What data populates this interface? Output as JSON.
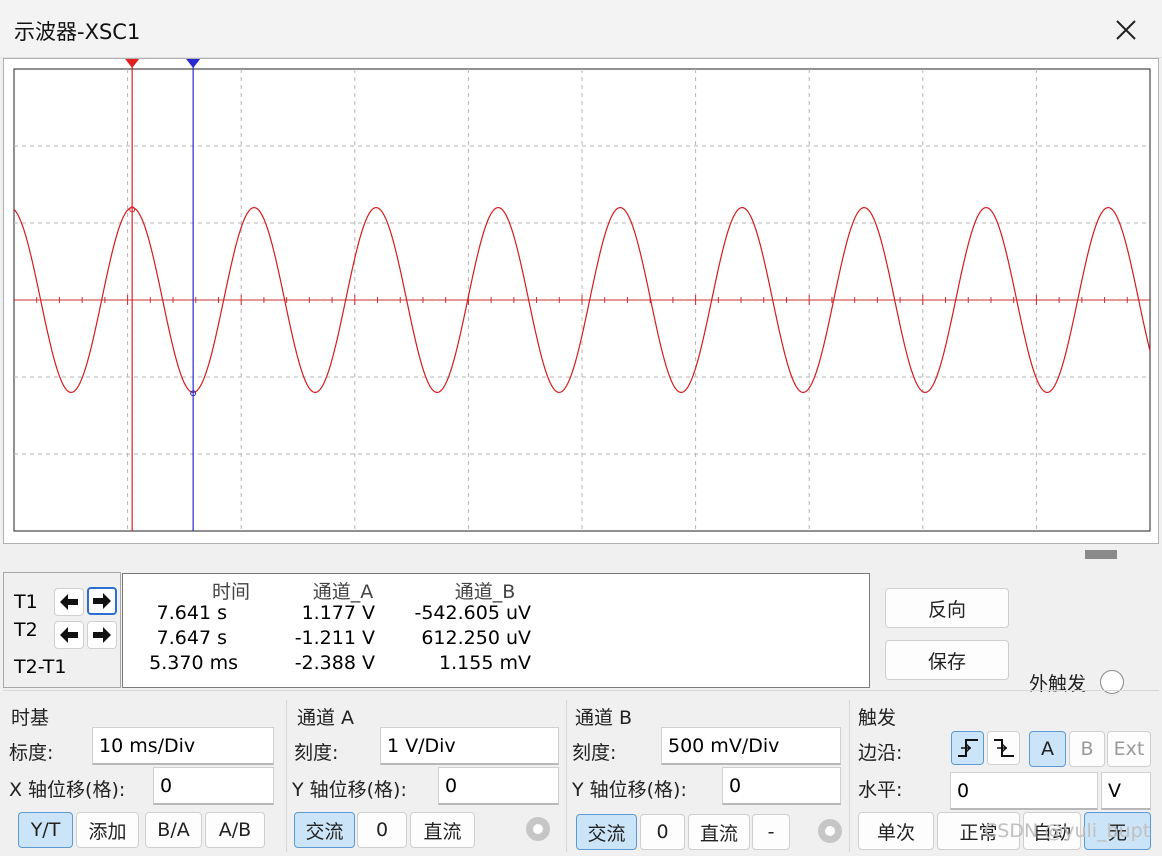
{
  "window": {
    "title": "示波器-XSC1"
  },
  "chart_data": {
    "type": "line",
    "title": "",
    "xlabel": "",
    "ylabel": "",
    "time_per_div_ms": 10,
    "volts_per_div": 1,
    "grid": true,
    "series": [
      {
        "channel": "A",
        "color": "#d41c1c",
        "waveform": "sine",
        "amplitude_V": 1.2,
        "period_ms": 10.74,
        "x_start_ms": -10.4,
        "x_end_ms": 89.6
      }
    ],
    "cursors": [
      {
        "name": "T1",
        "color": "#e02020",
        "t_ms": 0,
        "value_V": 1.177
      },
      {
        "name": "T2",
        "color": "#2a2ad0",
        "t_ms": 5.37,
        "value_V": -1.211
      }
    ]
  },
  "cursors_panel": {
    "t1": "T1",
    "t2": "T2",
    "diff": "T2-T1"
  },
  "readout": {
    "headers": {
      "time": "时间",
      "ch_a": "通道_A",
      "ch_b": "通道_B"
    },
    "t1": {
      "time": "7.641 s",
      "a": "1.177 V",
      "b": "-542.605 uV"
    },
    "t2": {
      "time": "7.647 s",
      "a": "-1.211 V",
      "b": "612.250 uV"
    },
    "diff": {
      "time": "5.370 ms",
      "a": "-2.388 V",
      "b": "1.155 mV"
    }
  },
  "actions": {
    "reverse": "反向",
    "save": "保存",
    "ext_trigger": "外触发"
  },
  "timebase": {
    "title": "时基",
    "scale_label": "标度:",
    "scale_value": "10 ms/Div",
    "xpos_label": "X 轴位移(格):",
    "xpos_value": "0",
    "modes": [
      "Y/T",
      "添加",
      "B/A",
      "A/B"
    ]
  },
  "channel_a": {
    "title": "通道 A",
    "scale_label": "刻度:",
    "scale_value": "1  V/Div",
    "ypos_label": "Y 轴位移(格):",
    "ypos_value": "0",
    "coupling": [
      "交流",
      "0",
      "直流"
    ]
  },
  "channel_b": {
    "title": "通道 B",
    "scale_label": "刻度:",
    "scale_value": "500 mV/Div",
    "ypos_label": "Y 轴位移(格):",
    "ypos_value": "0",
    "coupling": [
      "交流",
      "0",
      "直流",
      "-"
    ]
  },
  "trigger": {
    "title": "触发",
    "edge_label": "边沿:",
    "level_label": "水平:",
    "level_value": "0",
    "level_unit": "V",
    "sources": [
      "A",
      "B",
      "Ext"
    ],
    "modes": [
      "单次",
      "正常",
      "自动",
      "无"
    ]
  },
  "watermark": "CSDN @yuli_bupt"
}
